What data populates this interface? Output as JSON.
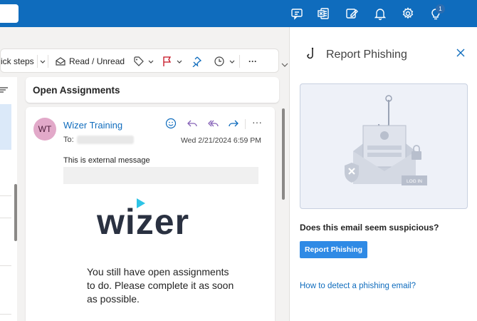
{
  "topbar": {
    "notification_count": "1",
    "icons": [
      "teams-chat-icon",
      "excel-icon",
      "feedback-icon",
      "bell-icon",
      "gear-icon",
      "lightbulb-icon"
    ],
    "accent": "#0f6cbd"
  },
  "ribbon": {
    "quick_steps": "ick steps",
    "read_unread": "Read / Unread",
    "more": "···"
  },
  "message": {
    "subject": "Open Assignments",
    "avatar_initials": "WT",
    "sender": "Wizer Training",
    "to_label": "To:",
    "date": "Wed 2/21/2024 6:59 PM",
    "external_notice": "This is external message",
    "logo_text": "wizer",
    "body": "You still have open assignments to do. Please complete it as soon as possible."
  },
  "panel": {
    "title": "Report Phishing",
    "illustration_button": "LOG IN",
    "question": "Does this email seem suspicious?",
    "button": "Report Phishing",
    "link": "How to detect a phishing email?",
    "button_color": "#2f8ae5"
  }
}
